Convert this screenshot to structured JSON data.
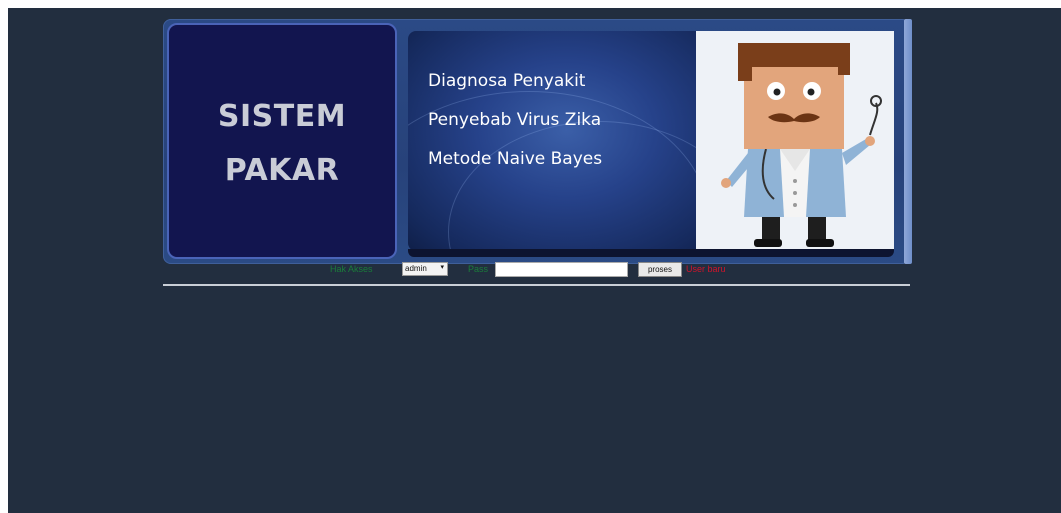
{
  "banner": {
    "logo_line1": "SISTEM",
    "logo_line2": "PAKAR",
    "title_line1": "Diagnosa Penyakit",
    "title_line2": "Penyebab Virus Zika",
    "title_line3": "Metode Naive Bayes"
  },
  "login_bar": {
    "role_label": "Hak Akses",
    "role_selected": "admin",
    "password_label": "Pass",
    "password_value": "",
    "submit_label": "proses",
    "user_label": "User baru"
  },
  "colors": {
    "page_background": "#222e3f",
    "logo_background": "#12154f",
    "label_green": "#1a7d3a",
    "label_red": "#d0142b"
  }
}
